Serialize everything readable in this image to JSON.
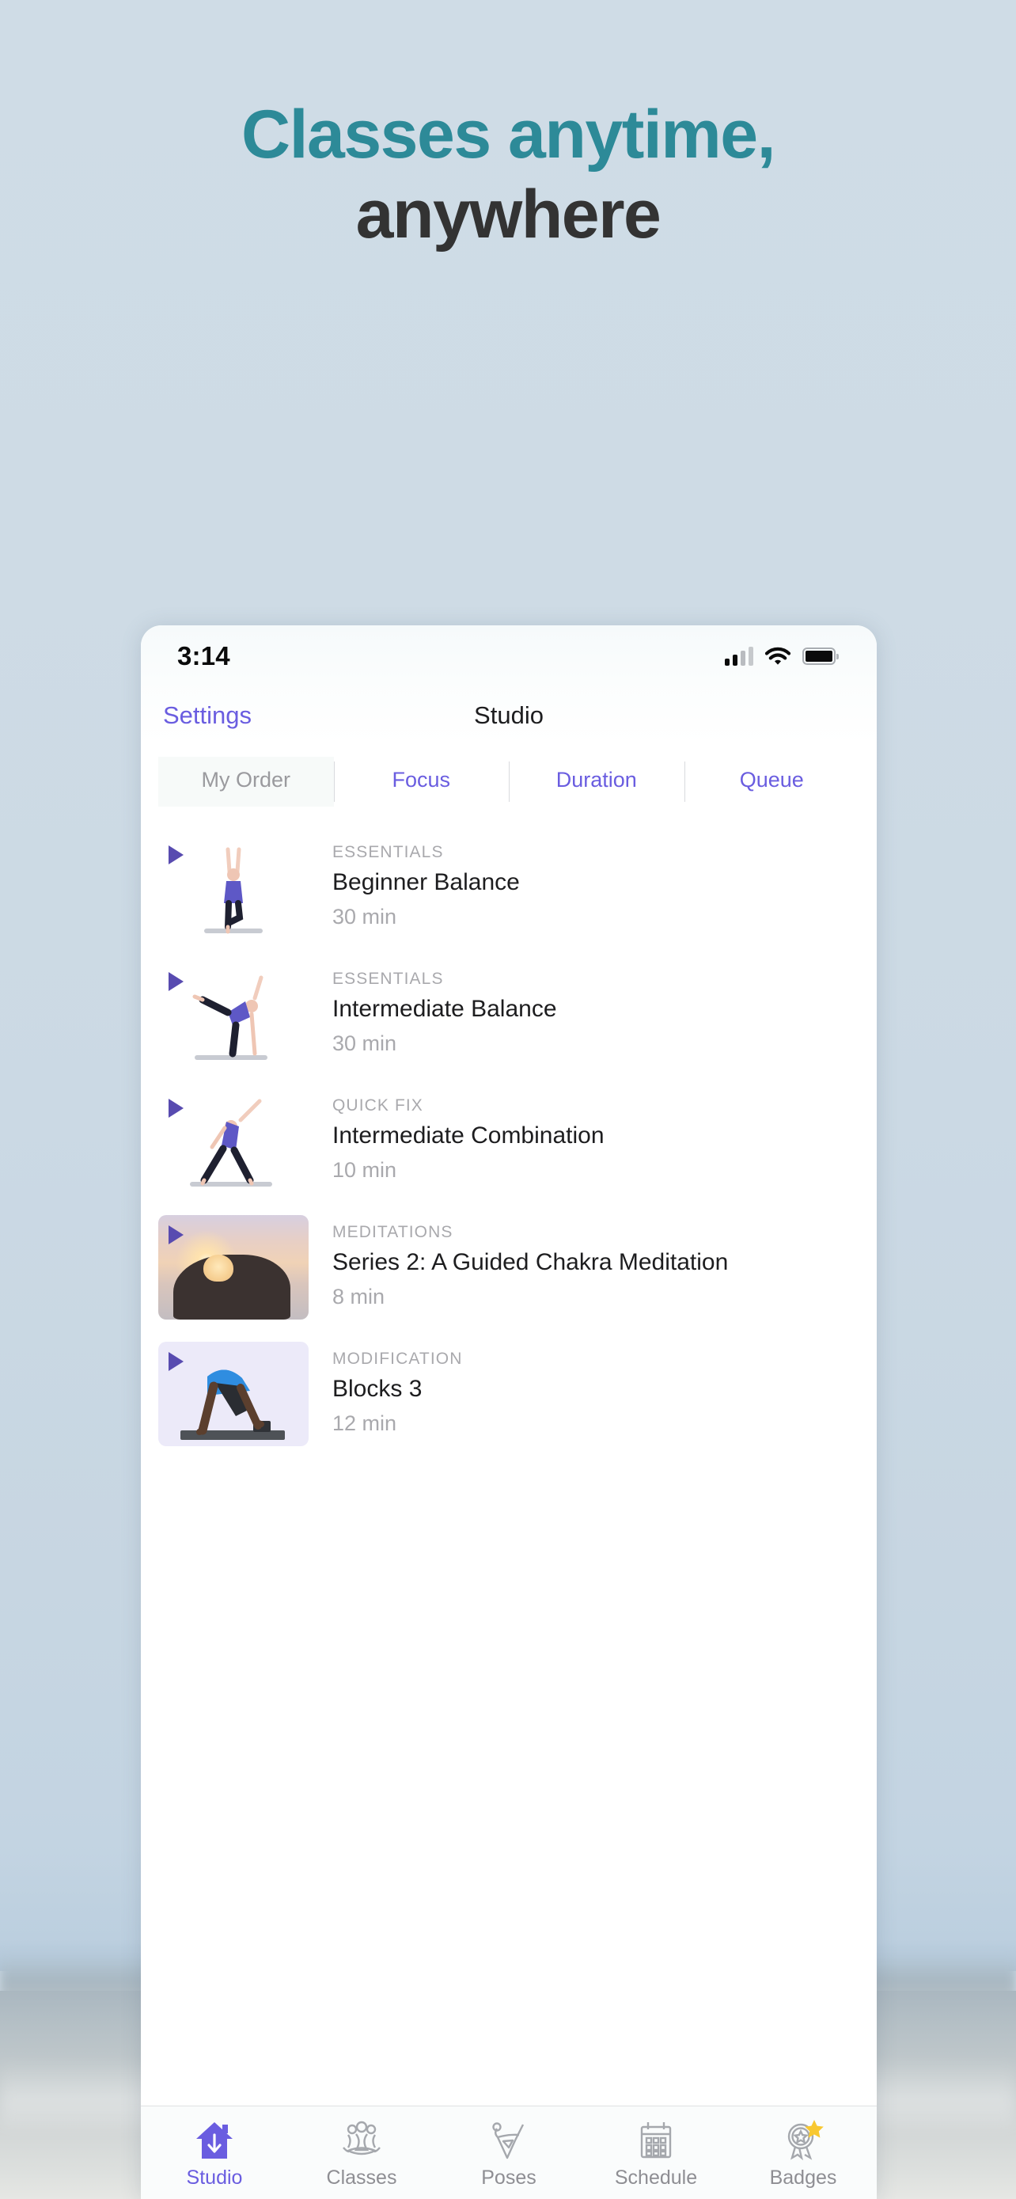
{
  "marketing": {
    "headline_line1": "Classes anytime,",
    "headline_line2": "anywhere",
    "headline_color_teal": "#2d8a98",
    "headline_color_dark": "#333333"
  },
  "theme": {
    "accent_purple": "#6a5de0",
    "play_purple": "#584bb0",
    "muted_gray": "#a9a9ad",
    "badge_star_yellow": "#f8c830"
  },
  "status_bar": {
    "time": "3:14",
    "signal_icon": "cellular-bars-icon",
    "wifi_icon": "wifi-icon",
    "battery_icon": "battery-icon"
  },
  "nav_bar": {
    "left_button": "Settings",
    "title": "Studio"
  },
  "segmented_control": {
    "selected_index": 0,
    "items": [
      {
        "label": "My Order",
        "selected": true
      },
      {
        "label": "Focus",
        "selected": false
      },
      {
        "label": "Duration",
        "selected": false
      },
      {
        "label": "Queue",
        "selected": false
      }
    ]
  },
  "class_list": [
    {
      "category": "ESSENTIALS",
      "title": "Beginner Balance",
      "duration": "30 min",
      "thumbnail": "yoga-tree-pose-thumbnail",
      "play_icon": "play-icon"
    },
    {
      "category": "ESSENTIALS",
      "title": "Intermediate Balance",
      "duration": "30 min",
      "thumbnail": "yoga-half-moon-pose-thumbnail",
      "play_icon": "play-icon"
    },
    {
      "category": "QUICK FIX",
      "title": "Intermediate Combination",
      "duration": "10 min",
      "thumbnail": "yoga-extended-side-angle-thumbnail",
      "play_icon": "play-icon"
    },
    {
      "category": "MEDITATIONS",
      "title": "Series 2: A Guided Chakra Meditation",
      "duration": "8 min",
      "thumbnail": "sunset-meditation-hand-photo",
      "play_icon": "play-icon"
    },
    {
      "category": "MODIFICATION",
      "title": "Blocks 3",
      "duration": "12 min",
      "thumbnail": "downward-dog-with-blocks-thumbnail",
      "play_icon": "play-icon"
    }
  ],
  "tab_bar": {
    "active_index": 0,
    "items": [
      {
        "label": "Studio",
        "icon": "house-download-icon",
        "active": true
      },
      {
        "label": "Classes",
        "icon": "group-meditation-icon",
        "active": false
      },
      {
        "label": "Poses",
        "icon": "yoga-pose-outline-icon",
        "active": false
      },
      {
        "label": "Schedule",
        "icon": "calendar-icon",
        "active": false
      },
      {
        "label": "Badges",
        "icon": "award-rosette-star-icon",
        "active": false
      }
    ]
  }
}
